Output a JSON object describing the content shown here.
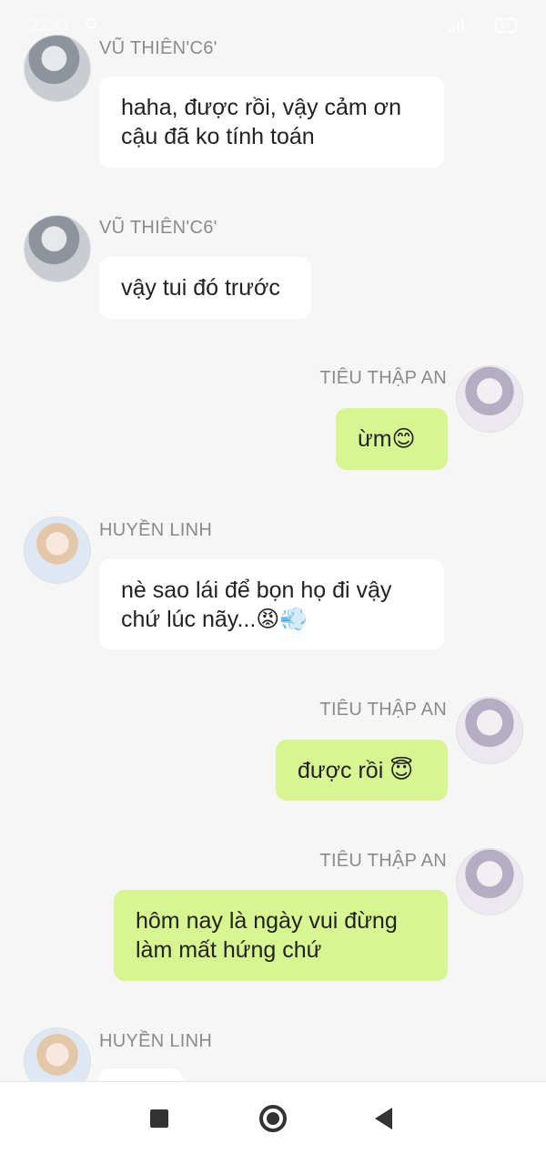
{
  "status_bar": {
    "time": "22:41",
    "battery": "21"
  },
  "messages": [
    {
      "sender": "VŨ THIÊN'C6'",
      "text": "haha, được rồi, vậy cảm ơn cậu đã ko tính toán",
      "side": "left"
    },
    {
      "sender": "VŨ THIÊN'C6'",
      "text": "vậy tui đó trước",
      "side": "left"
    },
    {
      "sender": "TIÊU THẬP AN",
      "text": "ừm😊",
      "side": "right"
    },
    {
      "sender": "HUYỀN LINH",
      "text": "nè sao lái để bọn họ đi vậy chứ lúc nãy...😡💨",
      "side": "left"
    },
    {
      "sender": "TIÊU THẬP AN",
      "text": "được rồi 😇",
      "side": "right"
    },
    {
      "sender": "TIÊU THẬP AN",
      "text": "hôm nay là ngày vui đừng làm mất hứng chứ",
      "side": "right"
    },
    {
      "sender": "HUYỀN LINH",
      "text": "",
      "side": "left"
    }
  ],
  "icons": {
    "status": [
      "settings-gear-icon",
      "signal-icon",
      "wifi-icon",
      "battery-icon"
    ],
    "nav": [
      "recent-apps-icon",
      "home-icon",
      "back-icon"
    ]
  },
  "colors": {
    "outgoing_bubble": "#d7f590",
    "incoming_bubble": "#ffffff",
    "background": "#f6f6f6"
  }
}
